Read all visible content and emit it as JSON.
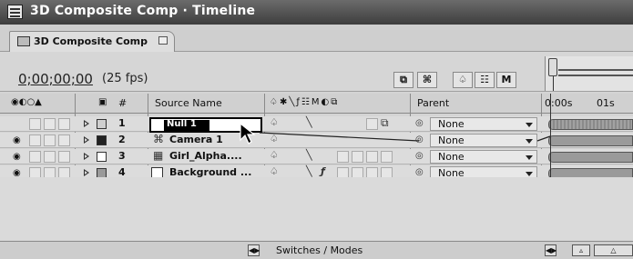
{
  "window": {
    "title": "3D Composite Comp · Timeline"
  },
  "tab": {
    "label": "3D Composite Comp"
  },
  "controls": {
    "timecode": "0;00;00;00",
    "fps": "(25 fps)",
    "btn_m": "M"
  },
  "headers": {
    "source_name": "Source Name",
    "num": "#",
    "parent": "Parent"
  },
  "ruler": {
    "t0": "0:00s",
    "t1": "01s"
  },
  "layers": [
    {
      "num": "1",
      "name": "Null 1",
      "parent": "None",
      "swatch": "#cfcfcf"
    },
    {
      "num": "2",
      "name": "Camera 1",
      "parent": "None",
      "swatch": "#222222"
    },
    {
      "num": "3",
      "name": "Girl_Alpha....",
      "parent": "None",
      "swatch": "#ffffff"
    },
    {
      "num": "4",
      "name": "Background ...",
      "parent": "None",
      "swatch": "#9a9a9a"
    }
  ],
  "bottom": {
    "switches_modes": "Switches / Modes"
  }
}
